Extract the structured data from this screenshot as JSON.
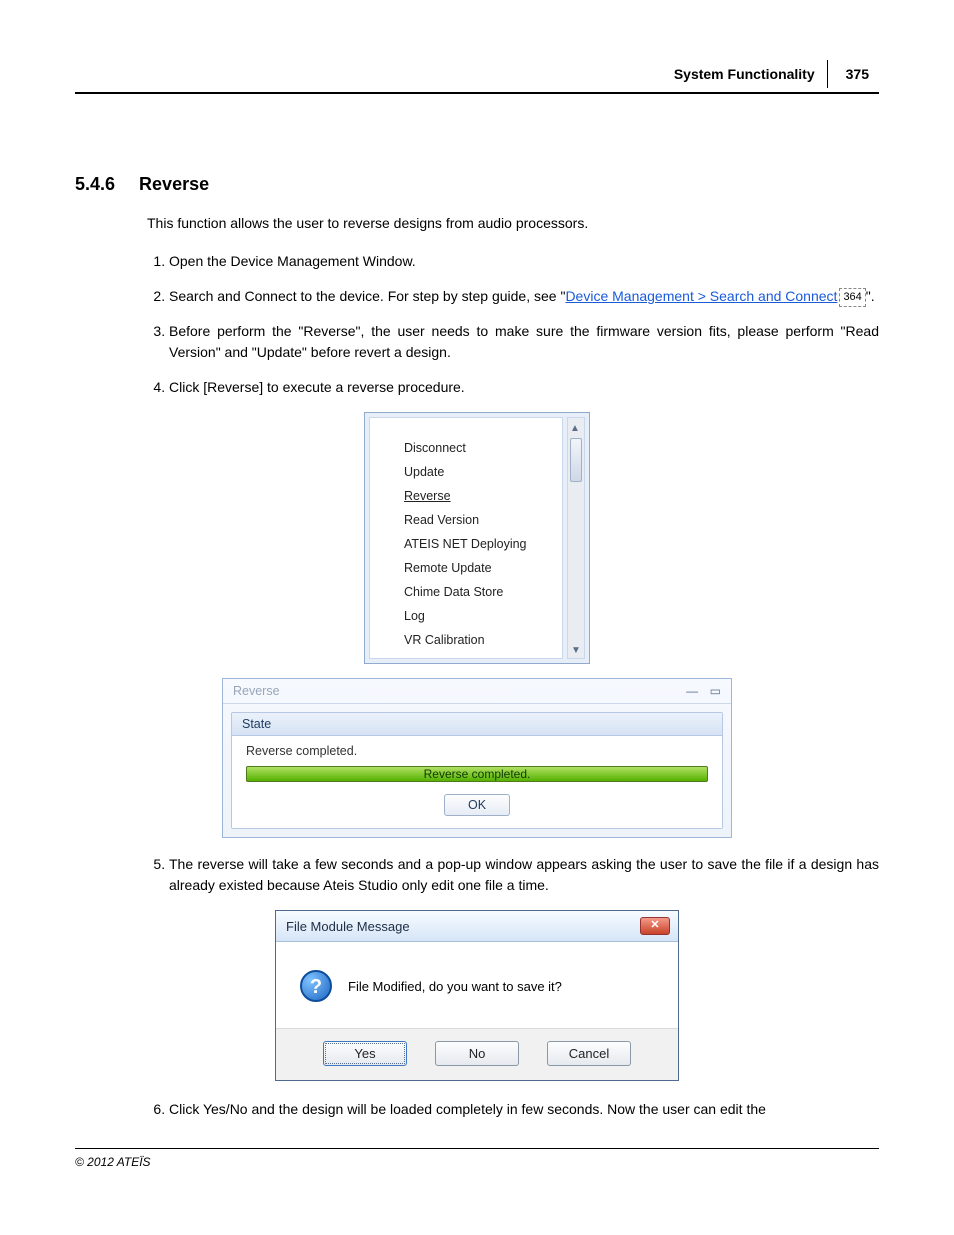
{
  "header": {
    "title": "System Functionality",
    "page": "375"
  },
  "section": {
    "number": "5.4.6",
    "title": "Reverse"
  },
  "intro": "This function allows the user to reverse designs from audio processors.",
  "steps": {
    "s1": "Open the Device Management Window.",
    "s2_prefix": "Search and Connect to the device. For step by step guide, see \"",
    "s2_link": "Device Management > Search and Connect",
    "s2_pgref": "364",
    "s2_suffix": "\".",
    "s3": "Before perform the \"Reverse\", the user needs to make sure the firmware version fits, please perform \"Read Version\" and \"Update\" before revert a design.",
    "s4": "Click [Reverse] to execute a reverse procedure.",
    "s5": "The reverse will take a few seconds and a pop-up window appears asking the user to save the file if a design has already existed because Ateis Studio only edit one file a time.",
    "s6": "Click Yes/No and the design will be loaded completely in few seconds. Now the user can edit the"
  },
  "menu": {
    "items": [
      "Disconnect",
      "Update",
      "Reverse",
      "Read Version",
      "ATEIS NET Deploying",
      "Remote Update",
      "Chime Data Store",
      "Log",
      "VR Calibration"
    ]
  },
  "reverse_window": {
    "title": "Reverse",
    "state_label": "State",
    "status_text": "Reverse completed.",
    "progress_text": "Reverse completed.",
    "ok": "OK"
  },
  "msg_window": {
    "title": "File Module Message",
    "body": "File Modified, do you want to save it?",
    "yes": "Yes",
    "no": "No",
    "cancel": "Cancel"
  },
  "footer": {
    "copyright": "© 2012 ATEÏS"
  }
}
